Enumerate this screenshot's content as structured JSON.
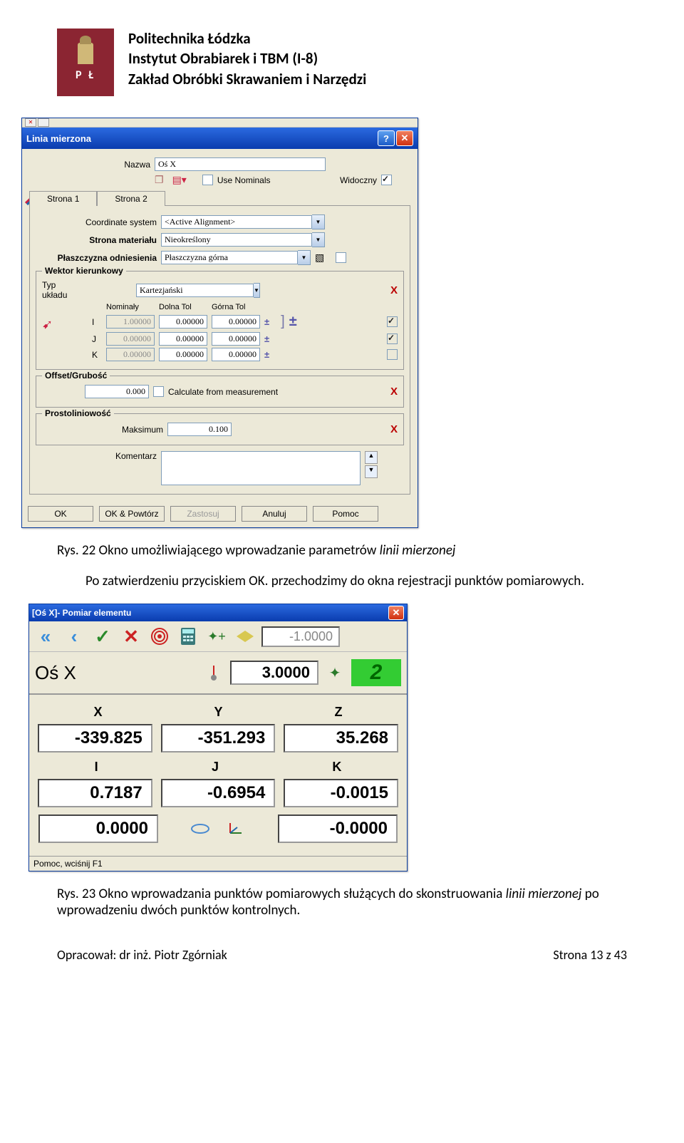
{
  "header": {
    "line1": "Politechnika Łódzka",
    "line2": "Instytut Obrabiarek i TBM (I-8)",
    "line3": "Zakład Obróbki Skrawaniem i Narzędzi",
    "logo_letters": "P Ł"
  },
  "dialog1": {
    "title": "Linia mierzona",
    "nazwa_lbl": "Nazwa",
    "nazwa_val": "Oś X",
    "use_nominals": "Use Nominals",
    "widoczny": "Widoczny",
    "tab1": "Strona 1",
    "tab2": "Strona 2",
    "coord_lbl": "Coordinate system",
    "coord_val": "<Active Alignment>",
    "strona_mat_lbl": "Strona materiału",
    "strona_mat_val": "Nieokreślony",
    "plasz_lbl": "Płaszczyzna odniesienia",
    "plasz_val": "Płaszczyzna górna",
    "wektor_grp": "Wektor kierunkowy",
    "typ_lbl": "Typ układu",
    "typ_val": "Kartezjański",
    "nominaly": "Nominały",
    "dolna": "Dolna Tol",
    "gorna": "Górna Tol",
    "i": "I",
    "j": "J",
    "k": "K",
    "i_nom": "1.00000",
    "i_dt": "0.00000",
    "i_gt": "0.00000",
    "j_nom": "0.00000",
    "j_dt": "0.00000",
    "j_gt": "0.00000",
    "k_nom": "0.00000",
    "k_dt": "0.00000",
    "k_gt": "0.00000",
    "offset_grp": "Offset/Grubość",
    "offset_val": "0.000",
    "calc_meas": "Calculate from measurement",
    "prost_grp": "Prostoliniowość",
    "maksimum": "Maksimum",
    "maks_val": "0.100",
    "komentarz": "Komentarz",
    "btn_ok": "OK",
    "btn_okp": "OK & Powtórz",
    "btn_zast": "Zastosuj",
    "btn_anul": "Anuluj",
    "btn_pomoc": "Pomoc"
  },
  "caption1_a": "Rys. 22 Okno umożliwiającego wprowadzanie parametrów ",
  "caption1_b": "linii mierzonej",
  "para1": "Po zatwierdzeniu przyciskiem OK. przechodzimy do okna rejestracji punktów pomiarowych.",
  "dialog2": {
    "title": "[Oś X]- Pomiar elementu",
    "topval": "-1.0000",
    "osx": "Oś X",
    "midval": "3.0000",
    "count": "2",
    "X": "X",
    "Y": "Y",
    "Z": "Z",
    "xval": "-339.825",
    "yval": "-351.293",
    "zval": "35.268",
    "I": "I",
    "J": "J",
    "K": "K",
    "ival": "0.7187",
    "jval": "-0.6954",
    "kval": "-0.0015",
    "b1": "0.0000",
    "b3": "-0.0000",
    "status": "Pomoc, wciśnij F1"
  },
  "caption2_a": "Rys. 23 Okno wprowadzania punktów pomiarowych służących do skonstruowania ",
  "caption2_b": "linii mierzonej",
  "caption2_c": " po wprowadzeniu dwóch punktów kontrolnych.",
  "footer_l": "Opracował: dr inż. Piotr Zgórniak",
  "footer_r": "Strona 13 z 43"
}
